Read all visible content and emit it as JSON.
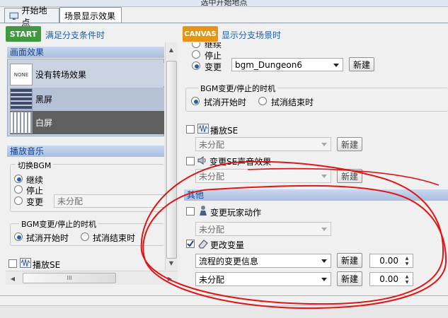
{
  "window": {
    "title": "选中开始地点"
  },
  "tabs": [
    {
      "label": "开始地点",
      "icon": "monitor-icon"
    },
    {
      "label": "场景显示效果",
      "icon": ""
    }
  ],
  "left": {
    "start_badge": "START",
    "start_caption": "满足分支条件时",
    "screen_effect_header": "画面效果",
    "effects": [
      {
        "thumb": "NONE",
        "label": "没有转场效果"
      },
      {
        "thumb": "",
        "label": "黑屏"
      },
      {
        "thumb": "",
        "label": "白屏"
      }
    ],
    "music_header": "播放音乐",
    "switch_bgm": {
      "legend": "切换BGM",
      "options": [
        "继续",
        "停止",
        "变更"
      ],
      "combo_value": "未分配"
    },
    "bgm_timing": {
      "legend": "BGM变更/停止的时机",
      "options": [
        "拭消开始时",
        "拭消结束时"
      ]
    },
    "play_se": "播放SE",
    "hscroll_mid": "III"
  },
  "right": {
    "canvas_badge": "CANVAS",
    "canvas_caption": "显示分支场景时",
    "bgm_options": [
      "继续",
      "停止",
      "变更"
    ],
    "bgm_combo": "bgm_Dungeon6",
    "new_label": "新建",
    "bgm_timing": {
      "legend": "BGM变更/停止的时机",
      "options": [
        "拭消开始时",
        "拭消结束时"
      ]
    },
    "play_se": "播放SE",
    "se_combo": "未分配",
    "change_se": "变更SE声音效果",
    "change_se_combo": "未分配",
    "other_header": "其他",
    "change_player_action": "变更玩家动作",
    "player_action_combo": "未分配",
    "change_variable": "更改变量",
    "variable_rows": [
      {
        "combo": "流程的变更信息",
        "value": "0.00"
      },
      {
        "combo": "未分配",
        "value": "0.00"
      }
    ]
  },
  "colors": {
    "accent_green": "#3f9a3f",
    "canvas_orange": "#e69512",
    "annotation_red": "#e01515"
  }
}
